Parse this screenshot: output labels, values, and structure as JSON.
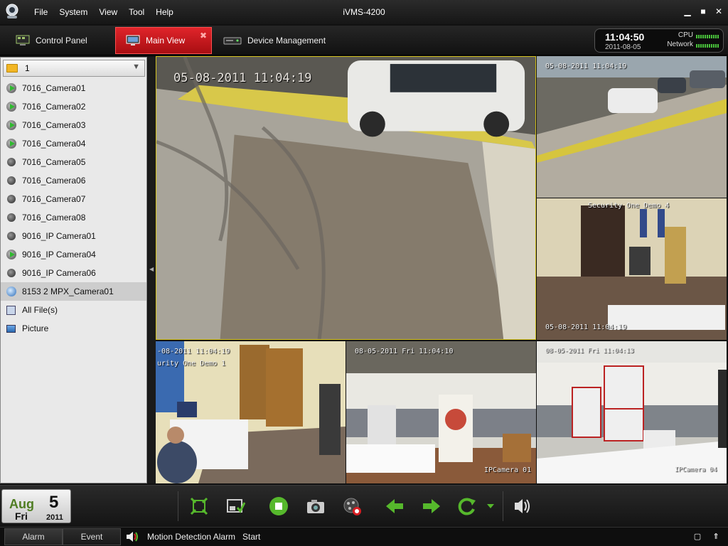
{
  "app": {
    "title": "iVMS-4200",
    "menu": [
      "File",
      "System",
      "View",
      "Tool",
      "Help"
    ]
  },
  "tabs": {
    "control_panel": "Control Panel",
    "main_view": "Main View",
    "device_management": "Device Management"
  },
  "status": {
    "time": "11:04:50",
    "date": "2011-08-05",
    "cpu_label": "CPU",
    "network_label": "Network"
  },
  "sidebar": {
    "group": "1",
    "cameras": [
      {
        "label": "7016_Camera01",
        "state": "live"
      },
      {
        "label": "7016_Camera02",
        "state": "live"
      },
      {
        "label": "7016_Camera03",
        "state": "live"
      },
      {
        "label": "7016_Camera04",
        "state": "live"
      },
      {
        "label": "7016_Camera05",
        "state": "idle"
      },
      {
        "label": "7016_Camera06",
        "state": "idle"
      },
      {
        "label": "7016_Camera07",
        "state": "idle"
      },
      {
        "label": "7016_Camera08",
        "state": "idle"
      },
      {
        "label": "9016_IP Camera01",
        "state": "idle"
      },
      {
        "label": "9016_IP Camera04",
        "state": "live"
      },
      {
        "label": "9016_IP Camera06",
        "state": "idle"
      },
      {
        "label": "8153 2 MPX_Camera01",
        "state": "ip",
        "selected": true
      }
    ],
    "all_files": "All File(s)",
    "picture": "Picture"
  },
  "videos": {
    "cell1_osd": "05-08-2011 11:04:19",
    "cell2_osd": "05-08-2011 11:04:19",
    "cell3_title": "Security One Demo 4",
    "cell3_osd": "05-08-2011 11:04:19",
    "cell4_osd": "-08-2011 11:04:19",
    "cell4_title": "urity One Demo 1",
    "cell5_osd": "08-05-2011 Fri 11:04:10",
    "cell5_name": "IPCamera 01",
    "cell6_osd": "08-05-2011 Fri 11:04:13",
    "cell6_name": "IPCamera 04"
  },
  "calendar": {
    "month": "Aug",
    "day": "5",
    "weekday": "Fri",
    "year": "2011"
  },
  "statusbar": {
    "alarm_tab": "Alarm",
    "event_tab": "Event",
    "message": "Motion Detection Alarm",
    "start": "Start"
  },
  "colors": {
    "accent_red": "#d81d22",
    "toolbar_green": "#56b82c",
    "selection_border": "#d4c21e"
  }
}
